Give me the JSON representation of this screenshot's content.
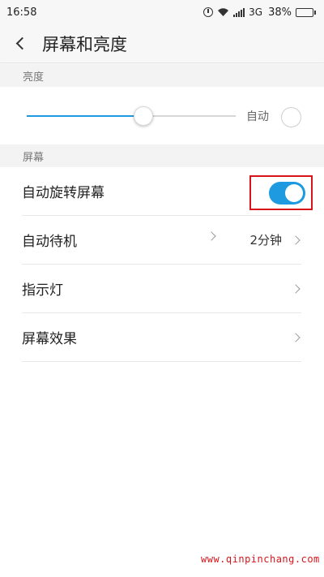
{
  "status_bar": {
    "time": "16:58",
    "network": "3G",
    "battery_percent": "38%",
    "battery_level": 0.38,
    "icons": [
      "alarm-icon",
      "wifi-icon",
      "signal-icon",
      "battery-icon"
    ]
  },
  "header": {
    "back_icon": "chevron-left-icon",
    "title": "屏幕和亮度"
  },
  "brightness_section": {
    "label": "亮度",
    "slider_value": 0.56,
    "auto_label": "自动",
    "auto_checked": false
  },
  "screen_section": {
    "label": "屏幕",
    "items": [
      {
        "label": "自动旋转屏幕",
        "toggle_on": true
      },
      {
        "label": "自动待机",
        "value": "2分钟"
      },
      {
        "label": "指示灯"
      },
      {
        "label": "屏幕效果"
      }
    ]
  },
  "colors": {
    "accent": "#1e9ae0",
    "highlight_box": "#d8141a"
  },
  "watermark": "www.qinpinchang.com"
}
